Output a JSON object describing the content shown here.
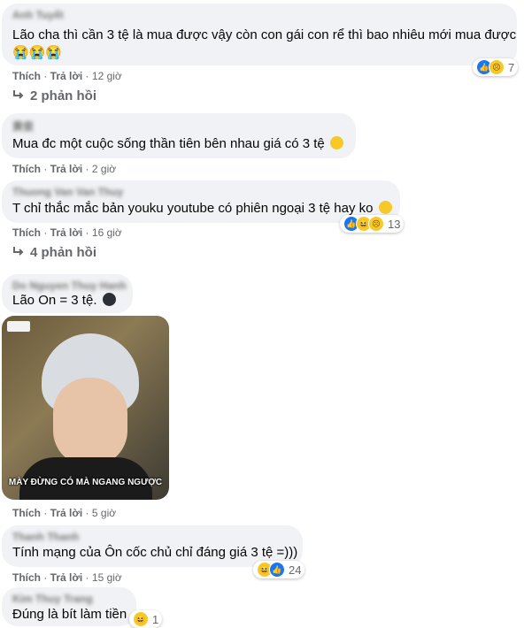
{
  "comments": [
    {
      "author": "Anh Tuyết",
      "text_line1": "Lão cha thì cần 3 tệ là mua được vậy còn con gái con rể thì bao nhiêu mới mua được",
      "text_line2": "😭😭😭",
      "like": "Thích",
      "reply": "Trả lời",
      "time": "12 giờ",
      "reaction_count": "7"
    },
    {
      "author": "黄俊",
      "text": "Mua đc một cuộc sống thần tiên bên nhau giá có 3 tệ",
      "like": "Thích",
      "reply": "Trả lời",
      "time": "2 giờ"
    },
    {
      "author": "Thuong Van Van Thuy",
      "text": "T chỉ thắc mắc bản youku youtube có phiên ngoại 3 tệ hay ko",
      "like": "Thích",
      "reply": "Trả lời",
      "time": "16 giờ",
      "reaction_count": "13"
    },
    {
      "author": "Do Nguyen Thuy Hanh",
      "text": "Lão On = 3 tệ.",
      "image_caption": "MÀY ĐỪNG CÓ MÀ NGANG NGƯỢC",
      "like": "Thích",
      "reply": "Trả lời",
      "time": "5 giờ"
    },
    {
      "author": "Thanh Thanh",
      "text": "Tính mạng của Ôn cốc chủ chỉ đáng giá 3 tệ =)))",
      "like": "Thích",
      "reply": "Trả lời",
      "time": "15 giờ",
      "reaction_count": "24"
    },
    {
      "author": "Kim Thuy Trang",
      "text": "Đúng là bít làm tiền",
      "reaction_count": "1"
    }
  ],
  "replies": [
    {
      "label": "2 phản hồi"
    },
    {
      "label": "4 phản hồi"
    }
  ],
  "icons": {
    "reply_arrow": "reply-arrow-icon",
    "like": "like-reaction-icon",
    "haha": "haha-reaction-icon",
    "sad": "sad-reaction-icon"
  },
  "colors": {
    "bubble": "#f0f2f5",
    "meta": "#65676b",
    "like_blue": "#1877f2",
    "emoji_yellow": "#f7c928"
  }
}
